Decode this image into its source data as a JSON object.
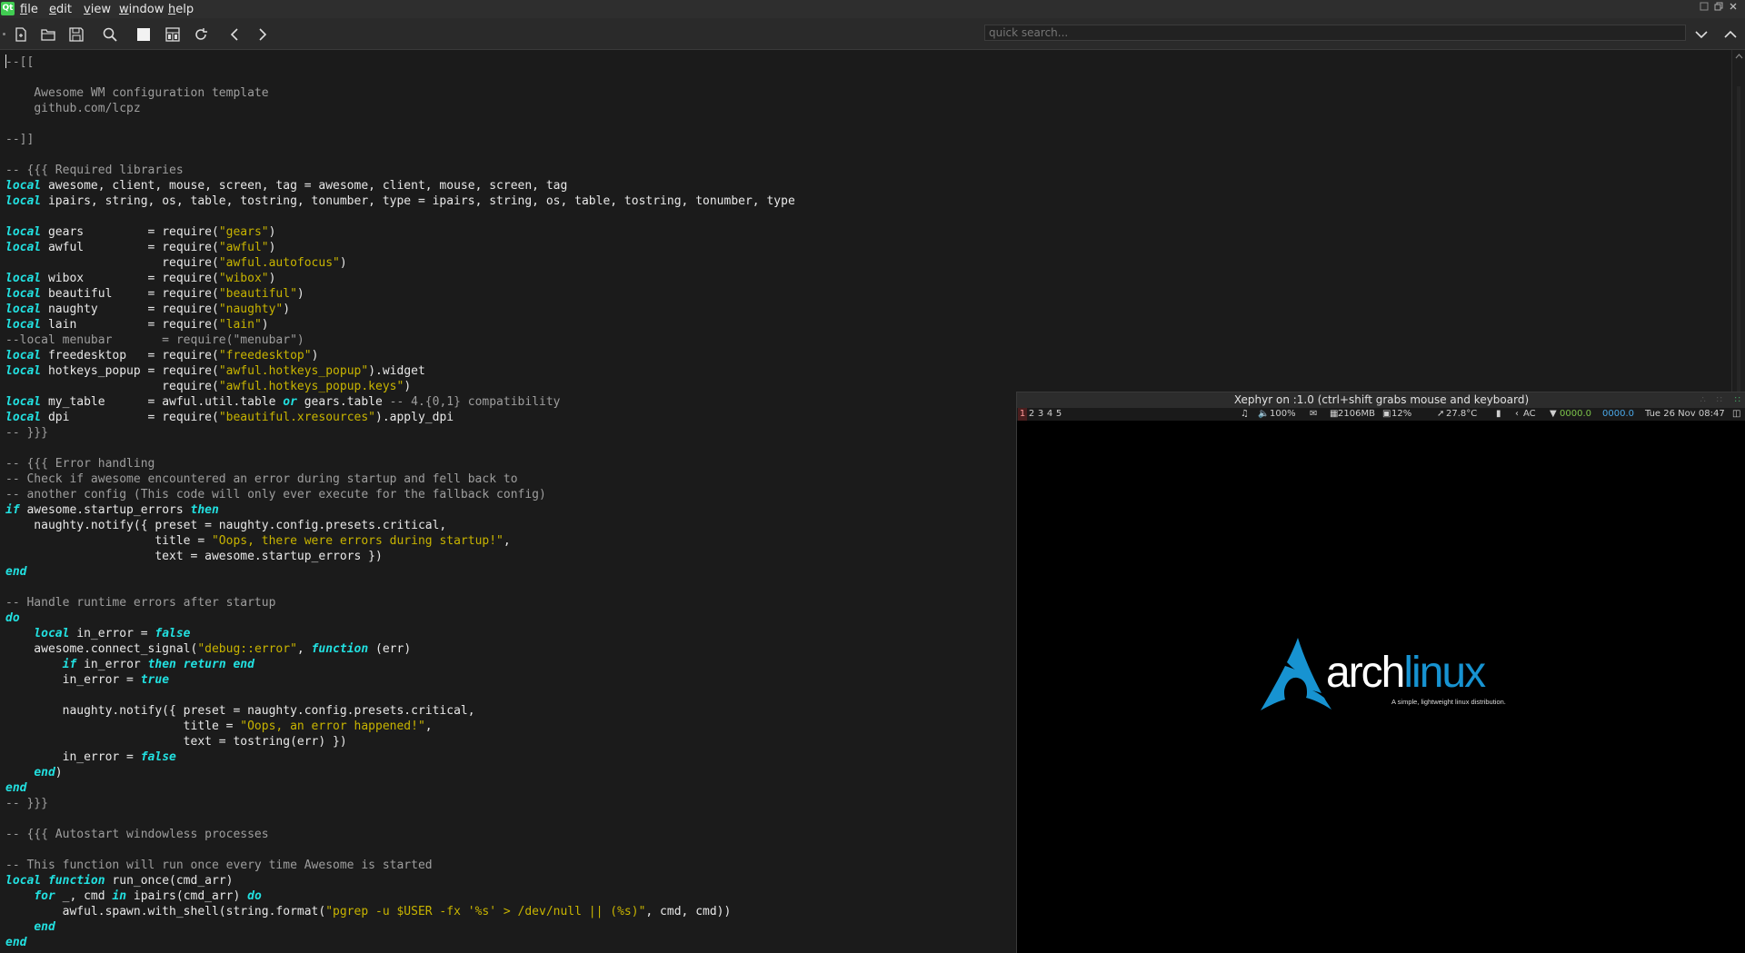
{
  "menubar": {
    "logo": "Qt",
    "items": [
      {
        "acc": "f",
        "rest": "ile"
      },
      {
        "acc": "e",
        "rest": "dit"
      },
      {
        "acc": "v",
        "rest": "iew"
      },
      {
        "acc": "w",
        "rest": "indow"
      },
      {
        "acc": "h",
        "rest": "elp"
      }
    ]
  },
  "toolbar": {
    "search_placeholder": "quick search..."
  },
  "code": [
    [
      [
        "cm",
        "--[["
      ]
    ],
    [],
    [
      [
        "",
        "    "
      ],
      [
        "cm",
        "Awesome WM configuration template"
      ]
    ],
    [
      [
        "",
        "    "
      ],
      [
        "cm",
        "github.com/lcpz"
      ]
    ],
    [],
    [
      [
        "cm",
        "--]]"
      ]
    ],
    [],
    [
      [
        "cm",
        "-- {{{ Required libraries"
      ]
    ],
    [
      [
        "kw",
        "local"
      ],
      [
        "",
        " awesome, client, mouse, screen, tag = awesome, client, mouse, screen, tag"
      ]
    ],
    [
      [
        "kw",
        "local"
      ],
      [
        "",
        " ipairs, string, os, table, tostring, tonumber, type = ipairs, string, os, table, tostring, tonumber, type"
      ]
    ],
    [],
    [
      [
        "kw",
        "local"
      ],
      [
        "",
        " gears         = require("
      ],
      [
        "st",
        "\"gears\""
      ],
      [
        "",
        ")"
      ]
    ],
    [
      [
        "kw",
        "local"
      ],
      [
        "",
        " awful         = require("
      ],
      [
        "st",
        "\"awful\""
      ],
      [
        "",
        ")"
      ]
    ],
    [
      [
        "",
        "                      require("
      ],
      [
        "st",
        "\"awful.autofocus\""
      ],
      [
        "",
        ")"
      ]
    ],
    [
      [
        "kw",
        "local"
      ],
      [
        "",
        " wibox         = require("
      ],
      [
        "st",
        "\"wibox\""
      ],
      [
        "",
        ")"
      ]
    ],
    [
      [
        "kw",
        "local"
      ],
      [
        "",
        " beautiful     = require("
      ],
      [
        "st",
        "\"beautiful\""
      ],
      [
        "",
        ")"
      ]
    ],
    [
      [
        "kw",
        "local"
      ],
      [
        "",
        " naughty       = require("
      ],
      [
        "st",
        "\"naughty\""
      ],
      [
        "",
        ")"
      ]
    ],
    [
      [
        "kw",
        "local"
      ],
      [
        "",
        " lain          = require("
      ],
      [
        "st",
        "\"lain\""
      ],
      [
        "",
        ")"
      ]
    ],
    [
      [
        "cm",
        "--local menubar       = require(\"menubar\")"
      ]
    ],
    [
      [
        "kw",
        "local"
      ],
      [
        "",
        " freedesktop   = require("
      ],
      [
        "st",
        "\"freedesktop\""
      ],
      [
        "",
        ")"
      ]
    ],
    [
      [
        "kw",
        "local"
      ],
      [
        "",
        " hotkeys_popup = require("
      ],
      [
        "st",
        "\"awful.hotkeys_popup\""
      ],
      [
        "",
        ").widget"
      ]
    ],
    [
      [
        "",
        "                      require("
      ],
      [
        "st",
        "\"awful.hotkeys_popup.keys\""
      ],
      [
        "",
        ")"
      ]
    ],
    [
      [
        "kw",
        "local"
      ],
      [
        "",
        " my_table      = awful.util.table "
      ],
      [
        "kw",
        "or"
      ],
      [
        "",
        " gears.table "
      ],
      [
        "cm",
        "-- 4.{0,1} compatibility"
      ]
    ],
    [
      [
        "kw",
        "local"
      ],
      [
        "",
        " dpi           = require("
      ],
      [
        "st",
        "\"beautiful.xresources\""
      ],
      [
        "",
        ").apply_dpi"
      ]
    ],
    [
      [
        "cm",
        "-- }}}"
      ]
    ],
    [],
    [
      [
        "cm",
        "-- {{{ Error handling"
      ]
    ],
    [
      [
        "cm",
        "-- Check if awesome encountered an error during startup and fell back to"
      ]
    ],
    [
      [
        "cm",
        "-- another config (This code will only ever execute for the fallback config)"
      ]
    ],
    [
      [
        "kw",
        "if"
      ],
      [
        "",
        " awesome.startup_errors "
      ],
      [
        "kw",
        "then"
      ]
    ],
    [
      [
        "",
        "    naughty.notify({ preset = naughty.config.presets.critical,"
      ]
    ],
    [
      [
        "",
        "                     title = "
      ],
      [
        "st",
        "\"Oops, there were errors during startup!\""
      ],
      [
        "",
        ","
      ]
    ],
    [
      [
        "",
        "                     text = awesome.startup_errors })"
      ]
    ],
    [
      [
        "kw",
        "end"
      ]
    ],
    [],
    [
      [
        "cm",
        "-- Handle runtime errors after startup"
      ]
    ],
    [
      [
        "kw",
        "do"
      ]
    ],
    [
      [
        "",
        "    "
      ],
      [
        "kw",
        "local"
      ],
      [
        "",
        " in_error = "
      ],
      [
        "kw",
        "false"
      ]
    ],
    [
      [
        "",
        "    awesome.connect_signal("
      ],
      [
        "st",
        "\"debug::error\""
      ],
      [
        "",
        ", "
      ],
      [
        "kw",
        "function"
      ],
      [
        "",
        " (err)"
      ]
    ],
    [
      [
        "",
        "        "
      ],
      [
        "kw",
        "if"
      ],
      [
        "",
        " in_error "
      ],
      [
        "kw",
        "then return end"
      ]
    ],
    [
      [
        "",
        "        in_error = "
      ],
      [
        "kw",
        "true"
      ]
    ],
    [],
    [
      [
        "",
        "        naughty.notify({ preset = naughty.config.presets.critical,"
      ]
    ],
    [
      [
        "",
        "                         title = "
      ],
      [
        "st",
        "\"Oops, an error happened!\""
      ],
      [
        "",
        ","
      ]
    ],
    [
      [
        "",
        "                         text = tostring(err) })"
      ]
    ],
    [
      [
        "",
        "        in_error = "
      ],
      [
        "kw",
        "false"
      ]
    ],
    [
      [
        "",
        "    "
      ],
      [
        "kw",
        "end"
      ],
      [
        "",
        ")"
      ]
    ],
    [
      [
        "kw",
        "end"
      ]
    ],
    [
      [
        "cm",
        "-- }}}"
      ]
    ],
    [],
    [
      [
        "cm",
        "-- {{{ Autostart windowless processes"
      ]
    ],
    [],
    [
      [
        "cm",
        "-- This function will run once every time Awesome is started"
      ]
    ],
    [
      [
        "kw",
        "local"
      ],
      [
        "",
        " "
      ],
      [
        "kw",
        "function"
      ],
      [
        "",
        " run_once(cmd_arr)"
      ]
    ],
    [
      [
        "",
        "    "
      ],
      [
        "kw",
        "for"
      ],
      [
        "",
        " _, cmd "
      ],
      [
        "kw",
        "in"
      ],
      [
        "",
        " ipairs(cmd_arr) "
      ],
      [
        "kw",
        "do"
      ]
    ],
    [
      [
        "",
        "        awful.spawn.with_shell(string.format("
      ],
      [
        "st",
        "\"pgrep -u $USER -fx '%s' > /dev/null || (%s)\""
      ],
      [
        "",
        ", cmd, cmd))"
      ]
    ],
    [
      [
        "",
        "    "
      ],
      [
        "kw",
        "end"
      ]
    ],
    [
      [
        "kw",
        "end"
      ]
    ]
  ],
  "xephyr": {
    "title": "Xephyr on :1.0 (ctrl+shift grabs mouse and keyboard)",
    "tags": [
      "1",
      "2",
      "3",
      "4",
      "5"
    ],
    "status": {
      "volume": "100%",
      "memory": "2106MB",
      "cpu": "12%",
      "temp": "27.8°C",
      "power": "AC",
      "net_down": "0000.0",
      "net_up": "0000.0",
      "datetime": "Tue 26 Nov 08:47"
    },
    "logo_text_arch": "arch",
    "logo_text_linux": "linux",
    "logo_tagline": "A simple, lightweight linux distribution."
  }
}
